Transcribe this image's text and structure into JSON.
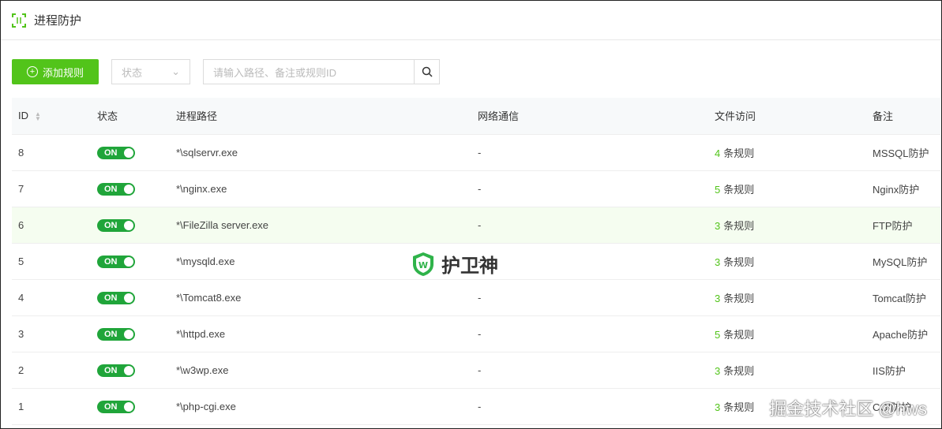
{
  "header": {
    "title": "进程防护"
  },
  "toolbar": {
    "add_label": "添加规则",
    "status_placeholder": "状态",
    "search_placeholder": "请输入路径、备注或规则ID"
  },
  "columns": [
    "ID",
    "状态",
    "进程路径",
    "网络通信",
    "文件访问",
    "备注"
  ],
  "rule_suffix": "条规则",
  "rows": [
    {
      "id": "8",
      "status": "ON",
      "path": "*\\sqlservr.exe",
      "net": "-",
      "files": "4",
      "note": "MSSQL防护"
    },
    {
      "id": "7",
      "status": "ON",
      "path": "*\\nginx.exe",
      "net": "-",
      "files": "5",
      "note": "Nginx防护"
    },
    {
      "id": "6",
      "status": "ON",
      "path": "*\\FileZilla server.exe",
      "net": "-",
      "files": "3",
      "note": "FTP防护"
    },
    {
      "id": "5",
      "status": "ON",
      "path": "*\\mysqld.exe",
      "net": "-",
      "files": "3",
      "note": "MySQL防护"
    },
    {
      "id": "4",
      "status": "ON",
      "path": "*\\Tomcat8.exe",
      "net": "-",
      "files": "3",
      "note": "Tomcat防护"
    },
    {
      "id": "3",
      "status": "ON",
      "path": "*\\httpd.exe",
      "net": "-",
      "files": "5",
      "note": "Apache防护"
    },
    {
      "id": "2",
      "status": "ON",
      "path": "*\\w3wp.exe",
      "net": "-",
      "files": "3",
      "note": "IIS防护"
    },
    {
      "id": "1",
      "status": "ON",
      "path": "*\\php-cgi.exe",
      "net": "-",
      "files": "3",
      "note": "CGI防护"
    }
  ],
  "watermark": {
    "logo_text": "护卫神",
    "site_text": "掘金技术社区 @hws"
  },
  "colors": {
    "accent": "#52c41a",
    "switch": "#20a53a"
  }
}
